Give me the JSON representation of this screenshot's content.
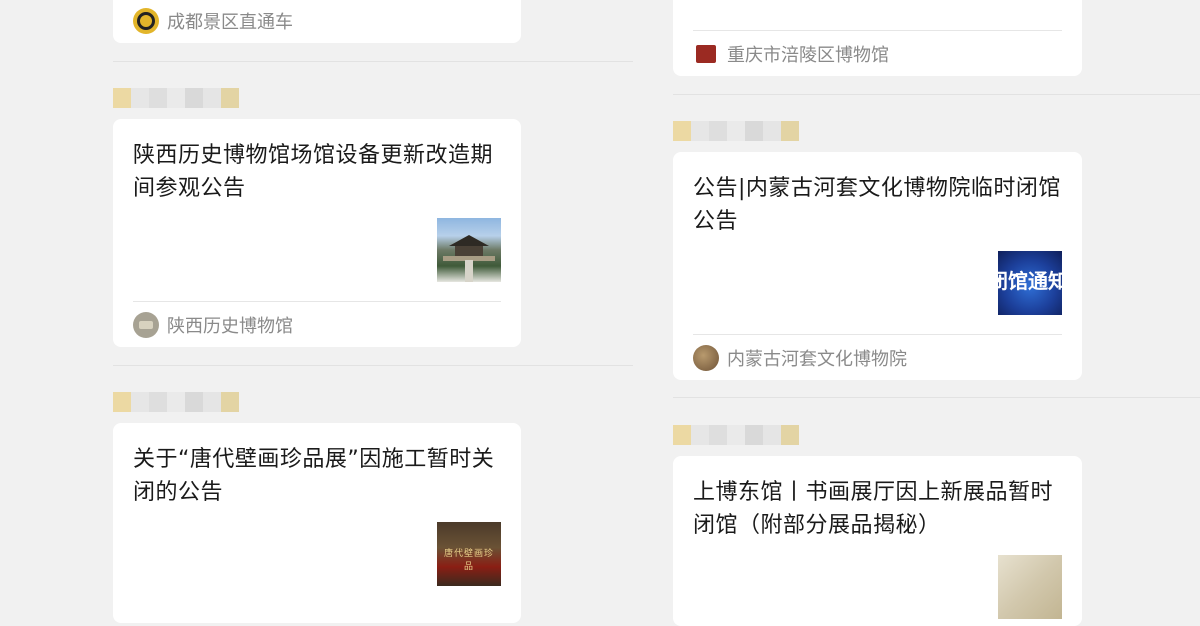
{
  "left_column": {
    "top_card": {
      "source": "成都景区直通车"
    },
    "card1": {
      "title": "陕西历史博物馆场馆设备更新改造期间参观公告",
      "source": "陕西历史博物馆"
    },
    "card2": {
      "title": "关于“唐代壁画珍品展”因施工暂时关闭的公告",
      "thumbnail_text": "唐代壁画珍品"
    }
  },
  "right_column": {
    "top_card": {
      "source": "重庆市涪陵区博物馆"
    },
    "card1": {
      "title": "公告|内蒙古河套文化博物院临时闭馆公告",
      "source": "内蒙古河套文化博物院",
      "thumbnail_text": "闭馆通知"
    },
    "card2": {
      "title": "上博东馆丨书画展厅因上新展品暂时闭馆（附部分展品揭秘）"
    }
  },
  "colors": {
    "background": "#f1f1f1",
    "card": "#ffffff",
    "title": "#1a1a1a",
    "source": "#8a8a8a"
  }
}
